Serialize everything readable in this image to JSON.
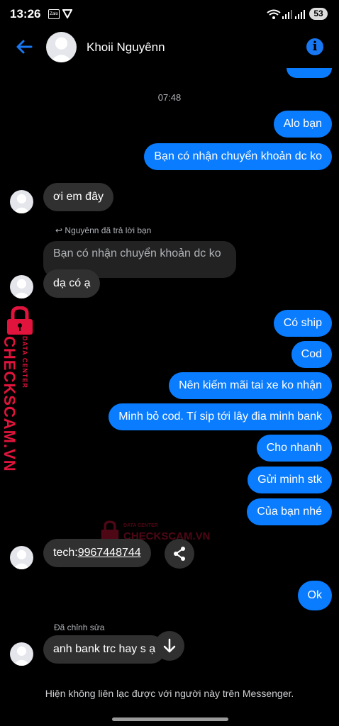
{
  "status_bar": {
    "time": "13:26",
    "notification_app": "Zalo",
    "battery": "53"
  },
  "header": {
    "contact_name": "Khoii Nguyênn"
  },
  "messages": {
    "top_timestamp": "07:48",
    "out_1": "Alo bạn",
    "out_2": "Bạn có nhận chuyển khoản dc ko",
    "in_1": "ơi em đây",
    "reply_label": "Nguyênn đã trả lời bạn",
    "quoted": "Bạn có nhận chuyển khoản dc ko",
    "in_2": "dạ có ạ",
    "out_3": "Có ship",
    "out_4": "Cod",
    "out_5": "Nên kiếm mãi tai xe ko nhận",
    "out_6": "Minh bỏ cod. Tí sip tới lây đia minh bank",
    "out_7": "Cho nhanh",
    "out_8": "Gửi minh stk",
    "out_9": "Của bạn nhé",
    "in_3_prefix": "tech:",
    "in_3_number": "9967448744",
    "out_10": "Ok",
    "edited_label": "Đã chỉnh sửa",
    "in_4": "anh bank trc hay s ạ"
  },
  "watermark": {
    "brand": "CHECKSCAM.VN",
    "sub": "DATA CENTER"
  },
  "footer": {
    "notice": "Hiện không liên lạc được với người này trên Messenger."
  },
  "colors": {
    "outgoing": "#0a7cff",
    "incoming": "#303030",
    "accent": "#1877f2",
    "watermark": "#e0143c"
  }
}
